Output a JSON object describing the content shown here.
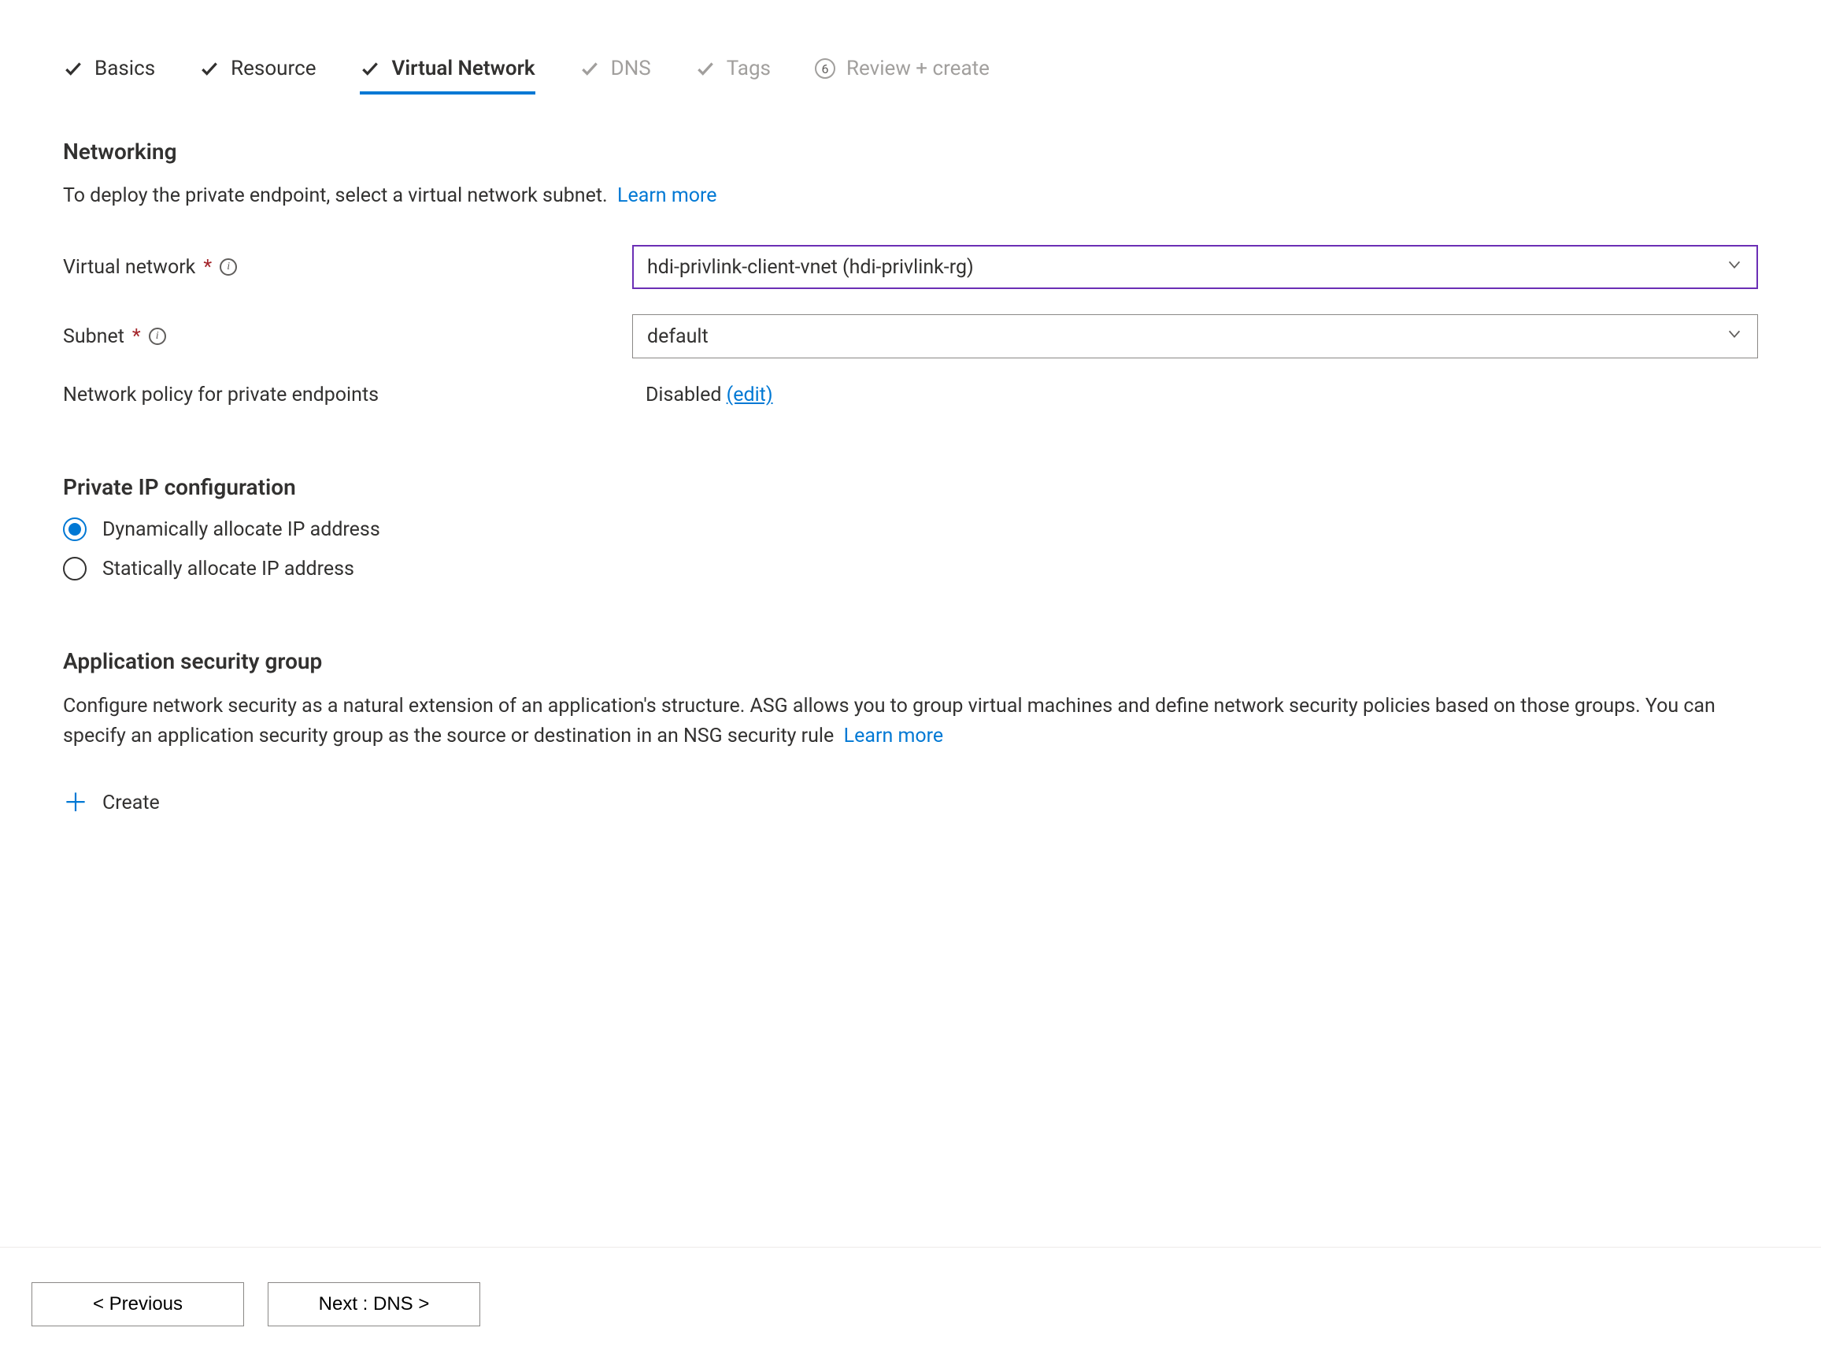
{
  "tabs": {
    "basics": "Basics",
    "resource": "Resource",
    "vnet": "Virtual Network",
    "dns": "DNS",
    "tags": "Tags",
    "review_step": "6",
    "review": "Review + create"
  },
  "networking": {
    "title": "Networking",
    "desc": "To deploy the private endpoint, select a virtual network subnet.",
    "learn_more": "Learn more",
    "vnet_label": "Virtual network",
    "vnet_value": "hdi-privlink-client-vnet (hdi-privlink-rg)",
    "subnet_label": "Subnet",
    "subnet_value": "default",
    "policy_label": "Network policy for private endpoints",
    "policy_value": "Disabled",
    "policy_edit": "(edit)"
  },
  "private_ip": {
    "title": "Private IP configuration",
    "dynamic": "Dynamically allocate IP address",
    "static": "Statically allocate IP address"
  },
  "asg": {
    "title": "Application security group",
    "desc": "Configure network security as a natural extension of an application's structure. ASG allows you to group virtual machines and define network security policies based on those groups. You can specify an application security group as the source or destination in an NSG security rule",
    "learn_more": "Learn more",
    "create": "Create"
  },
  "footer": {
    "previous": "< Previous",
    "next": "Next : DNS >"
  }
}
